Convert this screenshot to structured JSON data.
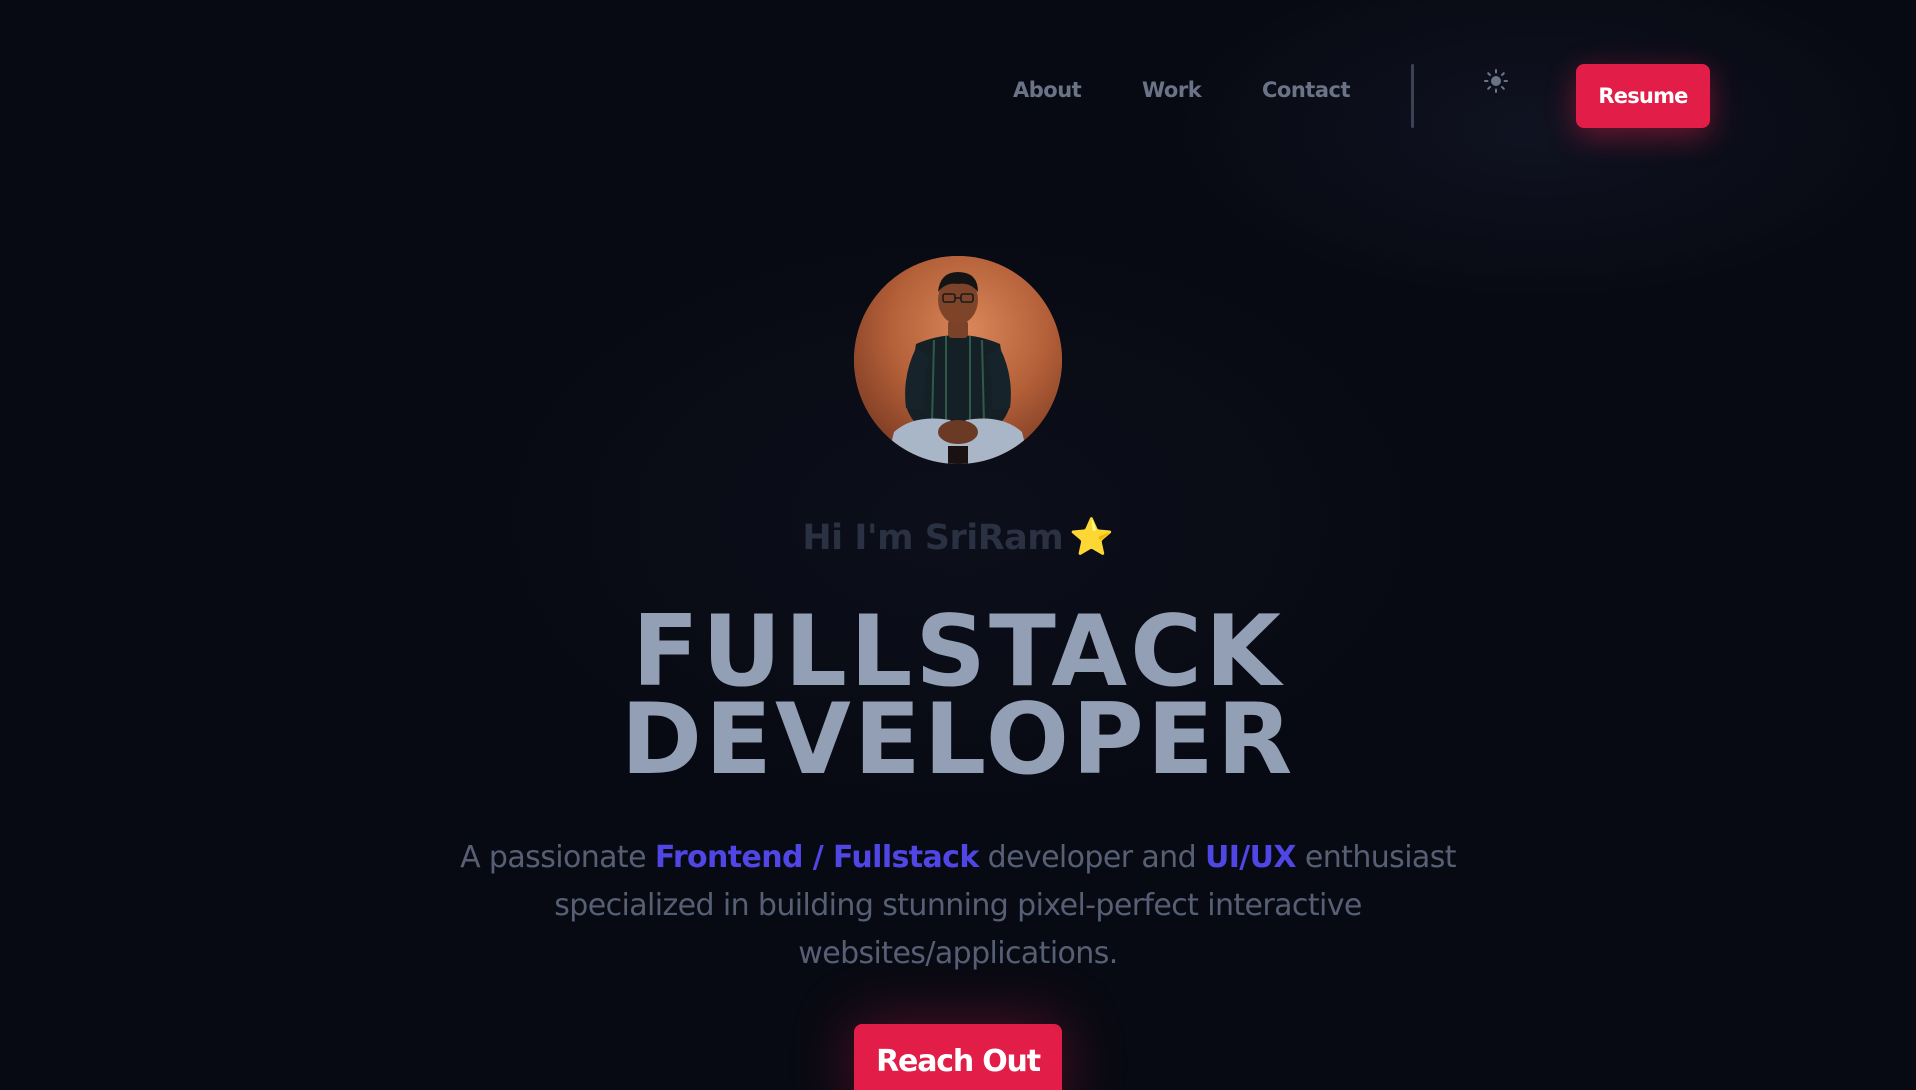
{
  "nav": {
    "links": [
      {
        "label": "About"
      },
      {
        "label": "Work"
      },
      {
        "label": "Contact"
      }
    ],
    "theme_toggle_icon": "sun-icon",
    "resume_label": "Resume"
  },
  "hero": {
    "avatar_alt": "SriRam",
    "greeting": "Hi I'm SriRam",
    "greeting_emoji": "⭐",
    "headline_line1": "FULLSTACK",
    "headline_line2": "DEVELOPER",
    "tagline": {
      "part1": "A passionate ",
      "highlight1": "Frontend / Fullstack",
      "part2": " developer and ",
      "highlight2": "UI/UX",
      "part3": " enthusiast specialized in building stunning pixel-perfect interactive websites/applications."
    },
    "cta_label": "Reach Out"
  },
  "colors": {
    "background": "#080a13",
    "accent": "#e11d48",
    "highlight": "#4f46e5",
    "headline": "#929fb4",
    "nav_text": "#6b7487"
  }
}
